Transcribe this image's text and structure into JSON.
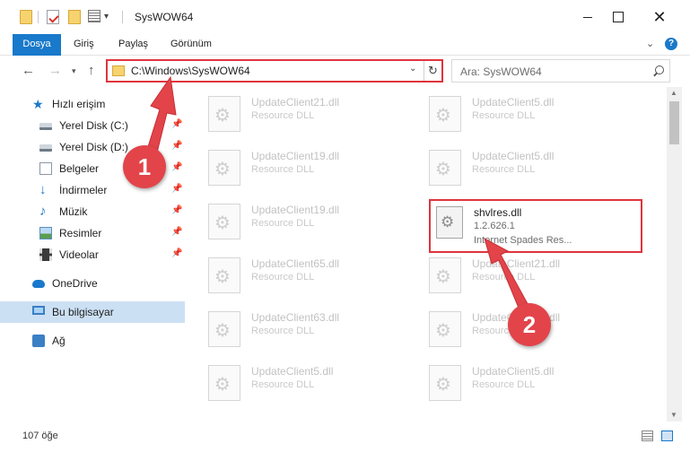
{
  "window": {
    "title": "SysWOW64"
  },
  "ribbon": {
    "tabs": [
      {
        "label": "Dosya"
      },
      {
        "label": "Giriş"
      },
      {
        "label": "Paylaş"
      },
      {
        "label": "Görünüm"
      }
    ]
  },
  "address": {
    "path": "C:\\Windows\\SysWOW64"
  },
  "search": {
    "placeholder": "Ara: SysWOW64"
  },
  "sidebar": {
    "items": [
      {
        "label": "Hızlı erişim",
        "icon": "star-icon"
      },
      {
        "label": "Yerel Disk (C:)",
        "icon": "drive-icon",
        "pinned": true
      },
      {
        "label": "Yerel Disk (D:)",
        "icon": "drive-icon",
        "pinned": true
      },
      {
        "label": "Belgeler",
        "icon": "document-icon",
        "pinned": true
      },
      {
        "label": "İndirmeler",
        "icon": "download-icon",
        "pinned": true
      },
      {
        "label": "Müzik",
        "icon": "music-icon",
        "pinned": true
      },
      {
        "label": "Resimler",
        "icon": "pictures-icon",
        "pinned": true
      },
      {
        "label": "Videolar",
        "icon": "video-icon",
        "pinned": true
      },
      {
        "label": "OneDrive",
        "icon": "cloud-icon"
      },
      {
        "label": "Bu bilgisayar",
        "icon": "computer-icon",
        "selected": true
      },
      {
        "label": "Ağ",
        "icon": "network-icon"
      }
    ]
  },
  "files": [
    {
      "name": "UpdateClient21.dll",
      "type": "Resource DLL"
    },
    {
      "name": "UpdateClient5.dll",
      "type": "Resource DLL"
    },
    {
      "name": "UpdateClient19.dll",
      "type": "Resource DLL"
    },
    {
      "name": "UpdateClient5.dll",
      "type": "Resource DLL"
    },
    {
      "name": "UpdateClient19.dll",
      "type": "Resource DLL"
    },
    {
      "name": "shvlres.dll",
      "version": "1.2.626.1",
      "type": "Internet Spades Res...",
      "highlighted": true
    },
    {
      "name": "UpdateClient65.dll",
      "type": "Resource DLL"
    },
    {
      "name": "UpdateClient21.dll",
      "type": "Resource DLL"
    },
    {
      "name": "UpdateClient63.dll",
      "type": "Resource DLL"
    },
    {
      "name": "UpdateClient42.dll",
      "type": "Resource DLL"
    },
    {
      "name": "UpdateClient5.dll",
      "type": "Resource DLL"
    },
    {
      "name": "UpdateClient5.dll",
      "type": "Resource DLL"
    }
  ],
  "status": {
    "item_count": "107 öğe"
  },
  "annotations": {
    "step1": "1",
    "step2": "2",
    "color": "#e2444a"
  }
}
